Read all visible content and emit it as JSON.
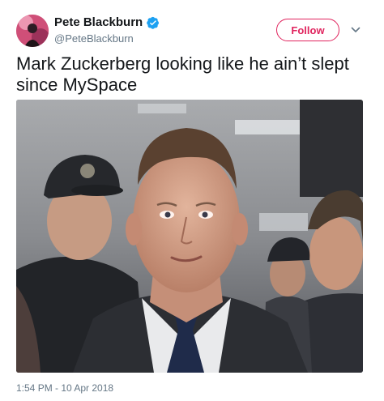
{
  "tweet": {
    "author": {
      "display_name": "Pete Blackburn",
      "handle": "@PeteBlackburn",
      "verified": true,
      "avatar_icon": "avatar-photo"
    },
    "follow_label": "Follow",
    "menu_icon": "chevron-down-icon",
    "text": "Mark Zuckerberg looking like he ain’t slept since MySpace",
    "media_icon": "photo-image",
    "timestamp": "1:54 PM - 10 Apr 2018"
  },
  "colors": {
    "accent": "#e0245e",
    "verified": "#1da1f2",
    "secondary_text": "#657786",
    "primary_text": "#14171a"
  }
}
